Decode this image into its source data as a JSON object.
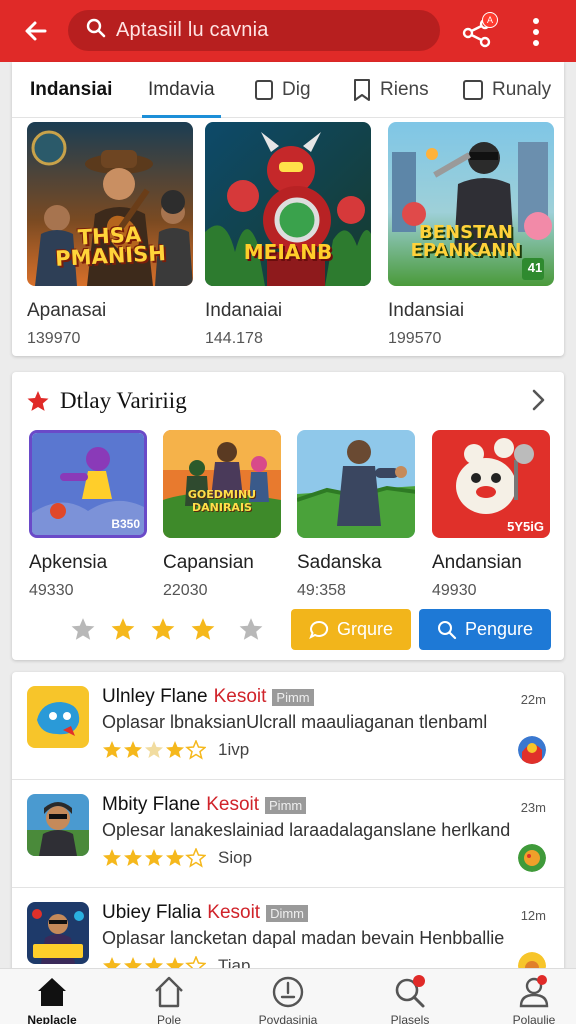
{
  "header": {
    "search_text": "Aptasiil lu cavnia",
    "share_badge": "A"
  },
  "tabs": [
    {
      "label": "Indansiai"
    },
    {
      "label": "Imdavia"
    },
    {
      "label": "Dig"
    },
    {
      "label": "Riens"
    },
    {
      "label": "Runaly"
    }
  ],
  "featured": [
    {
      "name": "Apanasai",
      "count": "139970",
      "art_text": "THSA PMANISH"
    },
    {
      "name": "Indanaiai",
      "count": "144.178",
      "art_text": "MEIANB"
    },
    {
      "name": "Indansiai",
      "count": "199570",
      "art_text": "BENSTAN EPANKANN",
      "art_badge": "41"
    }
  ],
  "section": {
    "title": "Dtlay Variriig",
    "apps": [
      {
        "name": "Apkensia",
        "count": "49330",
        "art_text": "B350"
      },
      {
        "name": "Capansian",
        "count": "22030",
        "art_text": "GOEDMINU DANIRAIS"
      },
      {
        "name": "Sadanska",
        "count": "49:358",
        "art_text": ""
      },
      {
        "name": "Andansian",
        "count": "49930",
        "art_text": "5Y5iG"
      }
    ],
    "btn_yellow": "Grqure",
    "btn_blue": "Pengure"
  },
  "list": [
    {
      "title": "Ulnley Flane",
      "tag": "Kesoit",
      "pill": "Pimm",
      "desc": "Oplasar lbnaksianUlcrall maauliaganan tlenbaml",
      "rating_label": "1ivp",
      "time": "22m"
    },
    {
      "title": "Mbity Flane",
      "tag": "Kesoit",
      "pill": "Pimm",
      "desc": "Oplesar lanakeslainiad laraadalaganslane herlkand",
      "rating_label": "Siop",
      "time": "23m"
    },
    {
      "title": "Ubiey Flalia",
      "tag": "Kesoit",
      "pill": "Dimm",
      "desc": "Oplasar lancketan dapal madan bevain Henbballie",
      "rating_label": "Tiap",
      "time": "12m"
    }
  ],
  "nav": [
    {
      "label": "Neplacle"
    },
    {
      "label": "Pole"
    },
    {
      "label": "Povdasinia"
    },
    {
      "label": "Plasels"
    },
    {
      "label": "Polaulie"
    }
  ],
  "colors": {
    "primary_red": "#e02a28",
    "accent_blue": "#1d8fd8",
    "button_yellow": "#f2b51b",
    "button_blue": "#1e79d6",
    "star": "#f5b81c"
  }
}
